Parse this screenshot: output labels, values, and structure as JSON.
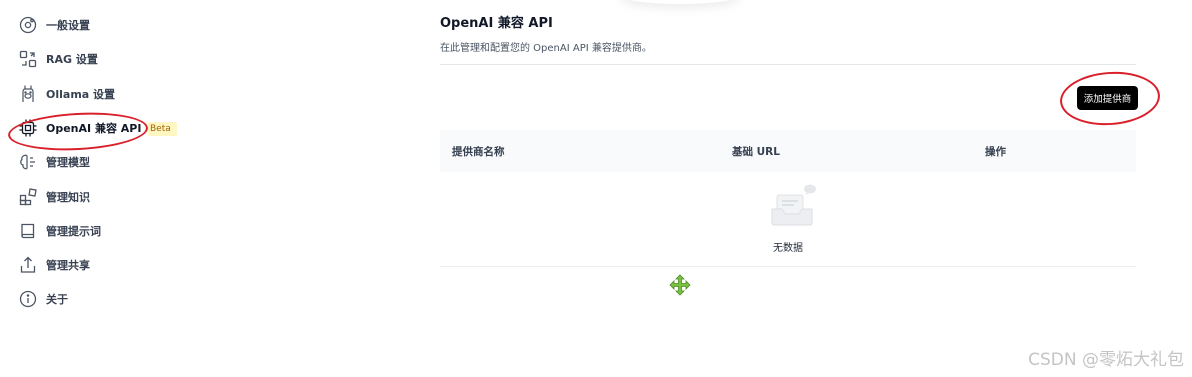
{
  "sidebar": {
    "items": [
      {
        "label": "一般设置",
        "icon": "gear-icon"
      },
      {
        "label": "RAG 设置",
        "icon": "file-link-icon"
      },
      {
        "label": "Ollama 设置",
        "icon": "llama-icon"
      },
      {
        "label": "OpenAI 兼容 API",
        "icon": "chip-icon",
        "badge": "Beta"
      },
      {
        "label": "管理模型",
        "icon": "brain-icon"
      },
      {
        "label": "管理知识",
        "icon": "blocks-icon"
      },
      {
        "label": "管理提示词",
        "icon": "book-icon"
      },
      {
        "label": "管理共享",
        "icon": "share-icon"
      },
      {
        "label": "关于",
        "icon": "info-icon"
      }
    ]
  },
  "main": {
    "title": "OpenAI 兼容 API",
    "subtitle": "在此管理和配置您的 OpenAI API 兼容提供商。",
    "add_button": "添加提供商",
    "table": {
      "columns": [
        "提供商名称",
        "基础 URL",
        "操作"
      ],
      "rows": [],
      "empty_text": "无数据"
    }
  },
  "watermark": "CSDN @零炻大礼包",
  "colors": {
    "annotation": "#d9202a",
    "button_bg": "#000000",
    "badge_bg": "#fff7c2",
    "cursor": "#7cc242"
  }
}
